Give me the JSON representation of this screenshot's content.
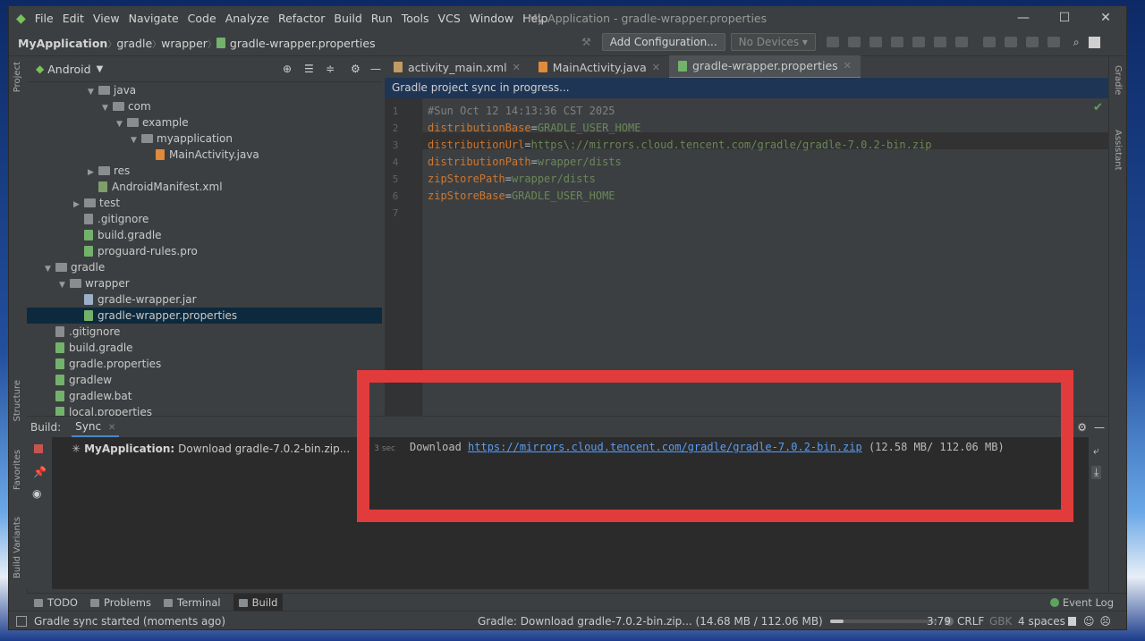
{
  "window": {
    "title": "My Application - gradle-wrapper.properties",
    "menu": [
      "File",
      "Edit",
      "View",
      "Navigate",
      "Code",
      "Analyze",
      "Refactor",
      "Build",
      "Run",
      "Tools",
      "VCS",
      "Window",
      "Help"
    ],
    "minimize": "—",
    "maximize": "☐",
    "close": "✕"
  },
  "navbar": {
    "crumbs": [
      "MyApplication",
      "gradle",
      "wrapper",
      "gradle-wrapper.properties"
    ],
    "add_config": "Add Configuration...",
    "devices": "No Devices"
  },
  "left_strip": {
    "project": "Project",
    "structure": "Structure",
    "favorites": "Favorites",
    "build_variants": "Build Variants"
  },
  "right_strip": {
    "gradle": "Gradle",
    "assistant": "Assistant"
  },
  "project": {
    "view": "Android",
    "tree": [
      {
        "label": "java",
        "depth": 4,
        "type": "folder",
        "expanded": true
      },
      {
        "label": "com",
        "depth": 5,
        "type": "folder",
        "expanded": true
      },
      {
        "label": "example",
        "depth": 6,
        "type": "folder",
        "expanded": true
      },
      {
        "label": "myapplication",
        "depth": 7,
        "type": "folder",
        "expanded": true
      },
      {
        "label": "MainActivity.java",
        "depth": 8,
        "type": "java"
      },
      {
        "label": "res",
        "depth": 4,
        "type": "folder",
        "expanded": false
      },
      {
        "label": "AndroidManifest.xml",
        "depth": 4,
        "type": "xml"
      },
      {
        "label": "test",
        "depth": 3,
        "type": "folder",
        "expanded": false
      },
      {
        "label": ".gitignore",
        "depth": 3,
        "type": "git"
      },
      {
        "label": "build.gradle",
        "depth": 3,
        "type": "gr"
      },
      {
        "label": "proguard-rules.pro",
        "depth": 3,
        "type": "gr"
      },
      {
        "label": "gradle",
        "depth": 1,
        "type": "folder",
        "expanded": true
      },
      {
        "label": "wrapper",
        "depth": 2,
        "type": "folder",
        "expanded": true
      },
      {
        "label": "gradle-wrapper.jar",
        "depth": 3,
        "type": "jar"
      },
      {
        "label": "gradle-wrapper.properties",
        "depth": 3,
        "type": "gr",
        "selected": true
      },
      {
        "label": ".gitignore",
        "depth": 1,
        "type": "git"
      },
      {
        "label": "build.gradle",
        "depth": 1,
        "type": "gr"
      },
      {
        "label": "gradle.properties",
        "depth": 1,
        "type": "gr"
      },
      {
        "label": "gradlew",
        "depth": 1,
        "type": "gr"
      },
      {
        "label": "gradlew.bat",
        "depth": 1,
        "type": "gr"
      },
      {
        "label": "local.properties",
        "depth": 1,
        "type": "gr"
      }
    ]
  },
  "editor": {
    "tabs": [
      {
        "label": "activity_main.xml",
        "color": "#c29b63",
        "active": false
      },
      {
        "label": "MainActivity.java",
        "color": "#e08a3e",
        "active": false
      },
      {
        "label": "gradle-wrapper.properties",
        "color": "#73b26b",
        "active": true
      }
    ],
    "sync_banner": "Gradle project sync in progress...",
    "lines": [
      {
        "n": "1",
        "comment": "#Sun Oct 12 14:13:36 CST 2025"
      },
      {
        "n": "2",
        "key": "distributionBase",
        "val": "GRADLE_USER_HOME"
      },
      {
        "n": "3",
        "key": "distributionUrl",
        "val": "https\\://mirrors.cloud.tencent.com/gradle/gradle-7.0.2-bin.zip"
      },
      {
        "n": "4",
        "key": "distributionPath",
        "val": "wrapper/dists"
      },
      {
        "n": "5",
        "key": "zipStorePath",
        "val": "wrapper/dists"
      },
      {
        "n": "6",
        "key": "zipStoreBase",
        "val": "GRADLE_USER_HOME"
      },
      {
        "n": "7"
      }
    ]
  },
  "build": {
    "label": "Build:",
    "tab": "Sync",
    "task_name": "MyApplication:",
    "task_text": "Download gradle-7.0.2-bin.zip...",
    "elapsed": "3 sec",
    "out_prefix": "Download ",
    "out_link": "https://mirrors.cloud.tencent.com/gradle/gradle-7.0.2-bin.zip",
    "out_suffix": " (12.58 MB/ 112.06 MB)"
  },
  "toolwindows": [
    "TODO",
    "Problems",
    "Terminal",
    "Build"
  ],
  "event_log": "Event Log",
  "status": {
    "left": "Gradle sync started (moments ago)",
    "task": "Gradle: Download gradle-7.0.2-bin.zip...  (14.68 MB / 112.06 MB)",
    "progress": 0.13,
    "pos": "3:79",
    "crlf": "CRLF",
    "enc": "GBK",
    "indent": "4 spaces"
  },
  "colors": {
    "accent": "#4a88c7",
    "highlight": "#e23b3b",
    "link": "#589df6"
  }
}
